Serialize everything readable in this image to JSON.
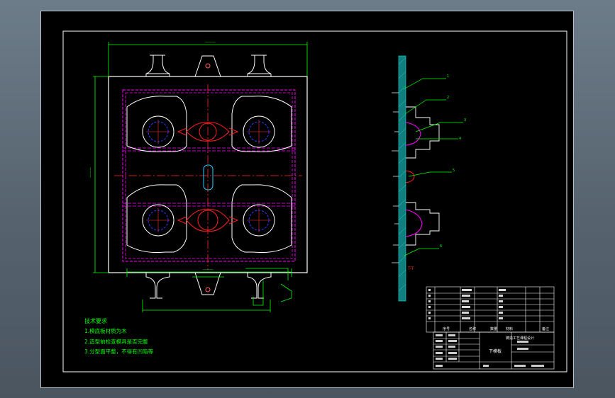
{
  "notes": {
    "title": "技术要求",
    "items": [
      "1.模底板材质为木",
      "2.造型前检查模具是否完整",
      "3.分型面平整，不得有凹陷等"
    ]
  },
  "section_label": "T-T",
  "parts_list": {
    "headers": [
      "序号",
      "名称",
      "数量",
      "材料",
      "备注"
    ],
    "subtitle": "铸造工艺课程设计"
  },
  "title_block": {
    "drawing_name": "下模板"
  },
  "colors": {
    "background": "#000000",
    "frame": "#ffffff",
    "dimension": "#00ff00",
    "centerline": "#ff00ff",
    "hidden_circle": "#0000ff",
    "leader": "#00ff00",
    "accent_red": "#ff0000",
    "section_fill": "#1ab8b8",
    "notes_text": "#00ff00"
  }
}
